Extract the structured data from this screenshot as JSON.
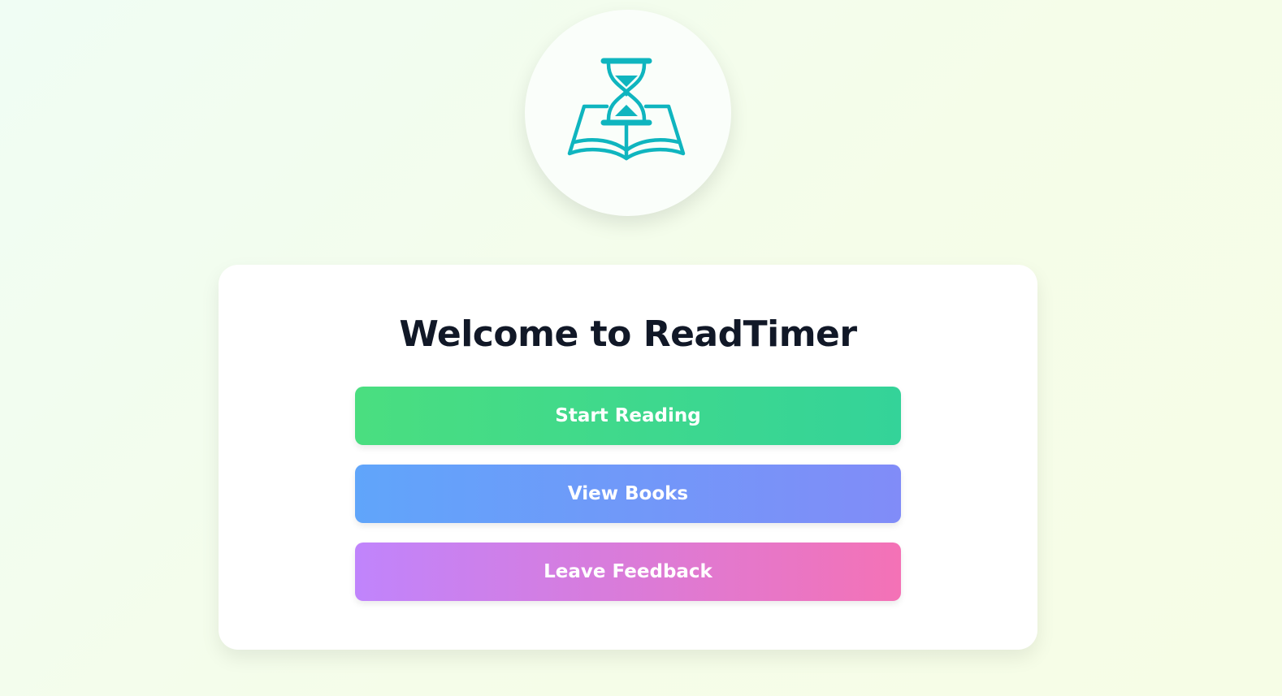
{
  "logo": {
    "icon": "hourglass-book-icon",
    "color": "#0fb5bf"
  },
  "card": {
    "title": "Welcome to ReadTimer"
  },
  "buttons": {
    "start_reading": "Start Reading",
    "view_books": "View Books",
    "leave_feedback": "Leave Feedback"
  },
  "colors": {
    "start_gradient": [
      "#4ade80",
      "#34d399"
    ],
    "books_gradient": [
      "#60a5fa",
      "#818cf8"
    ],
    "feedback_gradient": [
      "#c084fc",
      "#f472b6"
    ],
    "title": "#111827"
  }
}
